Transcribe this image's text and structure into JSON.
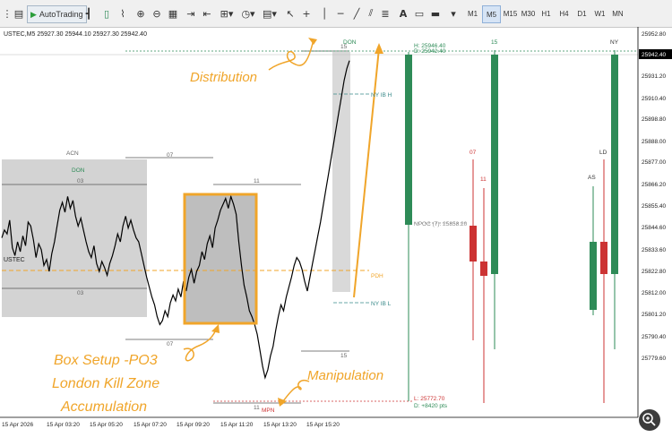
{
  "toolbar": {
    "autotrading_label": "AutoTrading",
    "timeframes": [
      "M1",
      "M5",
      "M15",
      "M30",
      "H1",
      "H4",
      "D1",
      "W1",
      "MN"
    ],
    "active_timeframe": "M5",
    "text_tool_label": "A"
  },
  "chart": {
    "header": "USTEC,M5  25927.30 25944.10 25927.30 25942.40",
    "symbol_label": "USTEC"
  },
  "price_axis": {
    "labels": [
      "25952.80",
      "25942.40",
      "25931.20",
      "25910.40",
      "25898.80",
      "25888.00",
      "25877.00",
      "25866.20",
      "25855.40",
      "25844.60",
      "25833.60",
      "25822.80",
      "25812.00",
      "25801.20",
      "25790.40",
      "25779.60"
    ],
    "current_price": "25942.40"
  },
  "time_axis": {
    "labels": [
      "15 Apr 2026",
      "15 Apr 03:20",
      "15 Apr 05:20",
      "15 Apr 07:20",
      "15 Apr 09:20",
      "15 Apr 11:20",
      "15 Apr 13:20",
      "15 Apr 15:20"
    ]
  },
  "session_labels": {
    "acn": "ACN",
    "don_left": "DON",
    "don_top": "DON",
    "n03_top": "03",
    "n03_bottom": "03",
    "n07_top": "07",
    "n07_bottom": "07",
    "n11_top": "11",
    "n11_bottom": "11",
    "n15_top": "15",
    "n15_bottom": "15",
    "mpn": "MPN"
  },
  "levels": {
    "h": "H: 25946.40",
    "d_top": "D: 25942.40",
    "nyibh": "NY IB H",
    "nyibl": "NY IB L",
    "pdh": "PDH",
    "npoc": "NPOC (7): 25858.20",
    "l": "L: 25772.70",
    "d_bottom": "D: +8420 pts"
  },
  "htf_labels": {
    "n15": "15",
    "n07": "07",
    "n11": "11",
    "ny": "NY",
    "ld": "LD",
    "as": "AS"
  },
  "annotations": {
    "distribution": "Distribution",
    "box_setup": "Box Setup -PO3",
    "london": "London Kill Zone",
    "accumulation": "Accumulation",
    "manipulation": "Manipulation"
  },
  "colors": {
    "bull": "#2e8b57",
    "bear": "#cc3333",
    "annotation": "#f0a52a",
    "level": "#3a8a8a",
    "session_box": "#d3d3d3",
    "pdh": "#f0a52a"
  },
  "price_series": [
    25852,
    25856,
    25854,
    25861,
    25847,
    25843,
    25850,
    25845,
    25853,
    25848,
    25860,
    25858,
    25851,
    25842,
    25849,
    25846,
    25838,
    25841,
    25835,
    25844,
    25850,
    25858,
    25866,
    25870,
    25865,
    25873,
    25867,
    25871,
    25863,
    25858,
    25862,
    25856,
    25850,
    25845,
    25842,
    25848,
    25839,
    25835,
    25840,
    25837,
    25833,
    25839,
    25843,
    25848,
    25854,
    25850,
    25858,
    25863,
    25857,
    25861,
    25856,
    25852,
    25850,
    25844,
    25838,
    25832,
    25827,
    25822,
    25818,
    25812,
    25808,
    25810,
    25815,
    25812,
    25819,
    25823,
    25820,
    25826,
    25822,
    25830,
    25825,
    25832,
    25836,
    25829,
    25835,
    25838,
    25845,
    25841,
    25849,
    25853,
    25847,
    25857,
    25861,
    25866,
    25869,
    25872,
    25867,
    25873,
    25869,
    25864,
    25850,
    25838,
    25828,
    25822,
    25815,
    25812,
    25808,
    25803,
    25795,
    25787,
    25781,
    25785,
    25792,
    25797,
    25805,
    25812,
    25818,
    25815,
    25822,
    25827,
    25832,
    25838,
    25842,
    25840,
    25836,
    25830,
    25825,
    25832,
    25839,
    25846,
    25853,
    25860,
    25868,
    25876,
    25884,
    25892,
    25900,
    25908,
    25916,
    25924,
    25932,
    25938,
    25942
  ]
}
